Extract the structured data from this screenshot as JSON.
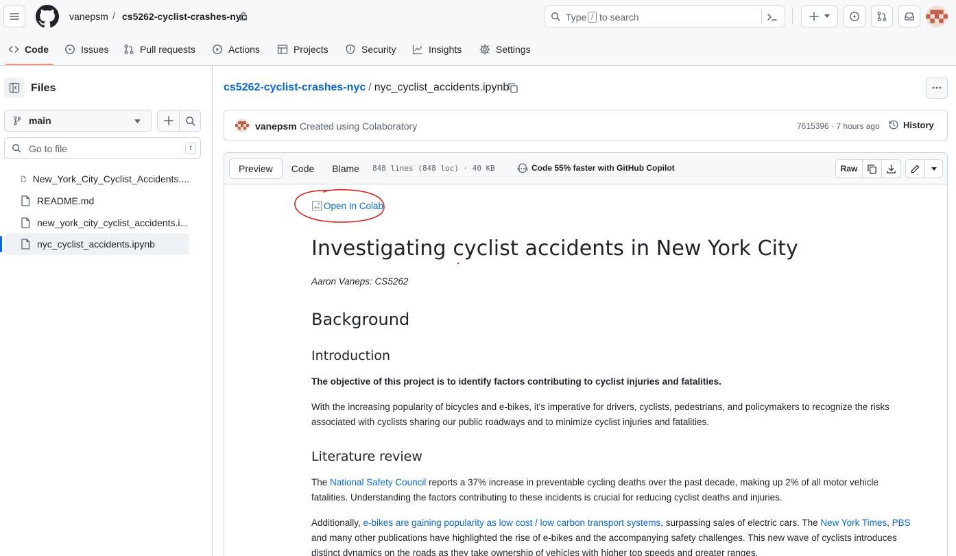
{
  "header": {
    "owner": "vanepsm",
    "separator": "/",
    "repo": "cs5262-cyclist-crashes-nyc",
    "search_type": "Type",
    "search_key": "/",
    "search_to": "to search"
  },
  "tabs": [
    {
      "label": "Code",
      "icon": "code-icon",
      "selected": true
    },
    {
      "label": "Issues",
      "icon": "issue-opened-icon"
    },
    {
      "label": "Pull requests",
      "icon": "git-pull-request-icon"
    },
    {
      "label": "Actions",
      "icon": "play-icon"
    },
    {
      "label": "Projects",
      "icon": "table-icon"
    },
    {
      "label": "Security",
      "icon": "shield-icon"
    },
    {
      "label": "Insights",
      "icon": "graph-icon"
    },
    {
      "label": "Settings",
      "icon": "gear-icon"
    }
  ],
  "sidebar": {
    "title": "Files",
    "branch": "main",
    "goto_placeholder": "Go to file",
    "goto_key": "t",
    "files": [
      {
        "name": "New_York_City_Cyclist_Accidents...."
      },
      {
        "name": "README.md"
      },
      {
        "name": "new_york_city_cyclist_accidents.i..."
      },
      {
        "name": "nyc_cyclist_accidents.ipynb",
        "active": true
      }
    ]
  },
  "breadcrumb": {
    "repo": "cs5262-cyclist-crashes-nyc",
    "separator": "/",
    "file": "nyc_cyclist_accidents.ipynb"
  },
  "commit": {
    "author": "vanepsm",
    "message": "Created using Colaboratory",
    "hash_time": "7615396 · 7 hours ago",
    "history_label": "History"
  },
  "file_toolbar": {
    "preview": "Preview",
    "code": "Code",
    "blame": "Blame",
    "stats": "848 lines (848 loc) · 40 KB",
    "copilot": "Code 55% faster with GitHub Copilot",
    "raw": "Raw"
  },
  "notebook": {
    "colab_alt": "Open In Colab",
    "title": "Investigating cyclist accidents in New York City",
    "author_line": "Aaron Vaneps: CS5262",
    "h_background": "Background",
    "h_intro": "Introduction",
    "objective": "The objective of this project is to identify factors contributing to cyclist injuries and fatalities.",
    "intro_p": "With the increasing popularity of bicycles and e-bikes, it's imperative for drivers, cyclists, pedestrians, and policymakers to recognize the risks associated with cyclists sharing our public roadways and to minimize cyclist injuries and fatalities.",
    "h_lit": "Literature review",
    "lit_p1_pre": "The ",
    "lit_p1_link": "National Safety Council",
    "lit_p1_post": " reports a 37% increase in preventable cycling deaths over the past decade, making up 2% of all motor vehicle fatalities. Understanding the factors contributing to these incidents is crucial for reducing cyclist deaths and injuries.",
    "lit_p2_pre": "Additionally, ",
    "lit_p2_link1": "e-bikes are gaining popularity as low cost / low carbon transport systems",
    "lit_p2_mid": ", surpassing sales of electric cars. The ",
    "lit_p2_link2": "New York Times",
    "lit_p2_comma": ", ",
    "lit_p2_link3": "PBS",
    "lit_p2_post": " and many other publications have highlighted the rise of e-bikes and the accompanying safety challenges. This new wave of cyclists introduces distinct dynamics on the roads as they take ownership of vehicles with higher top speeds and greater ranges."
  },
  "colors": {
    "link": "#0969da",
    "annotation": "#e0201a",
    "tab_underline": "#fd8c73"
  }
}
